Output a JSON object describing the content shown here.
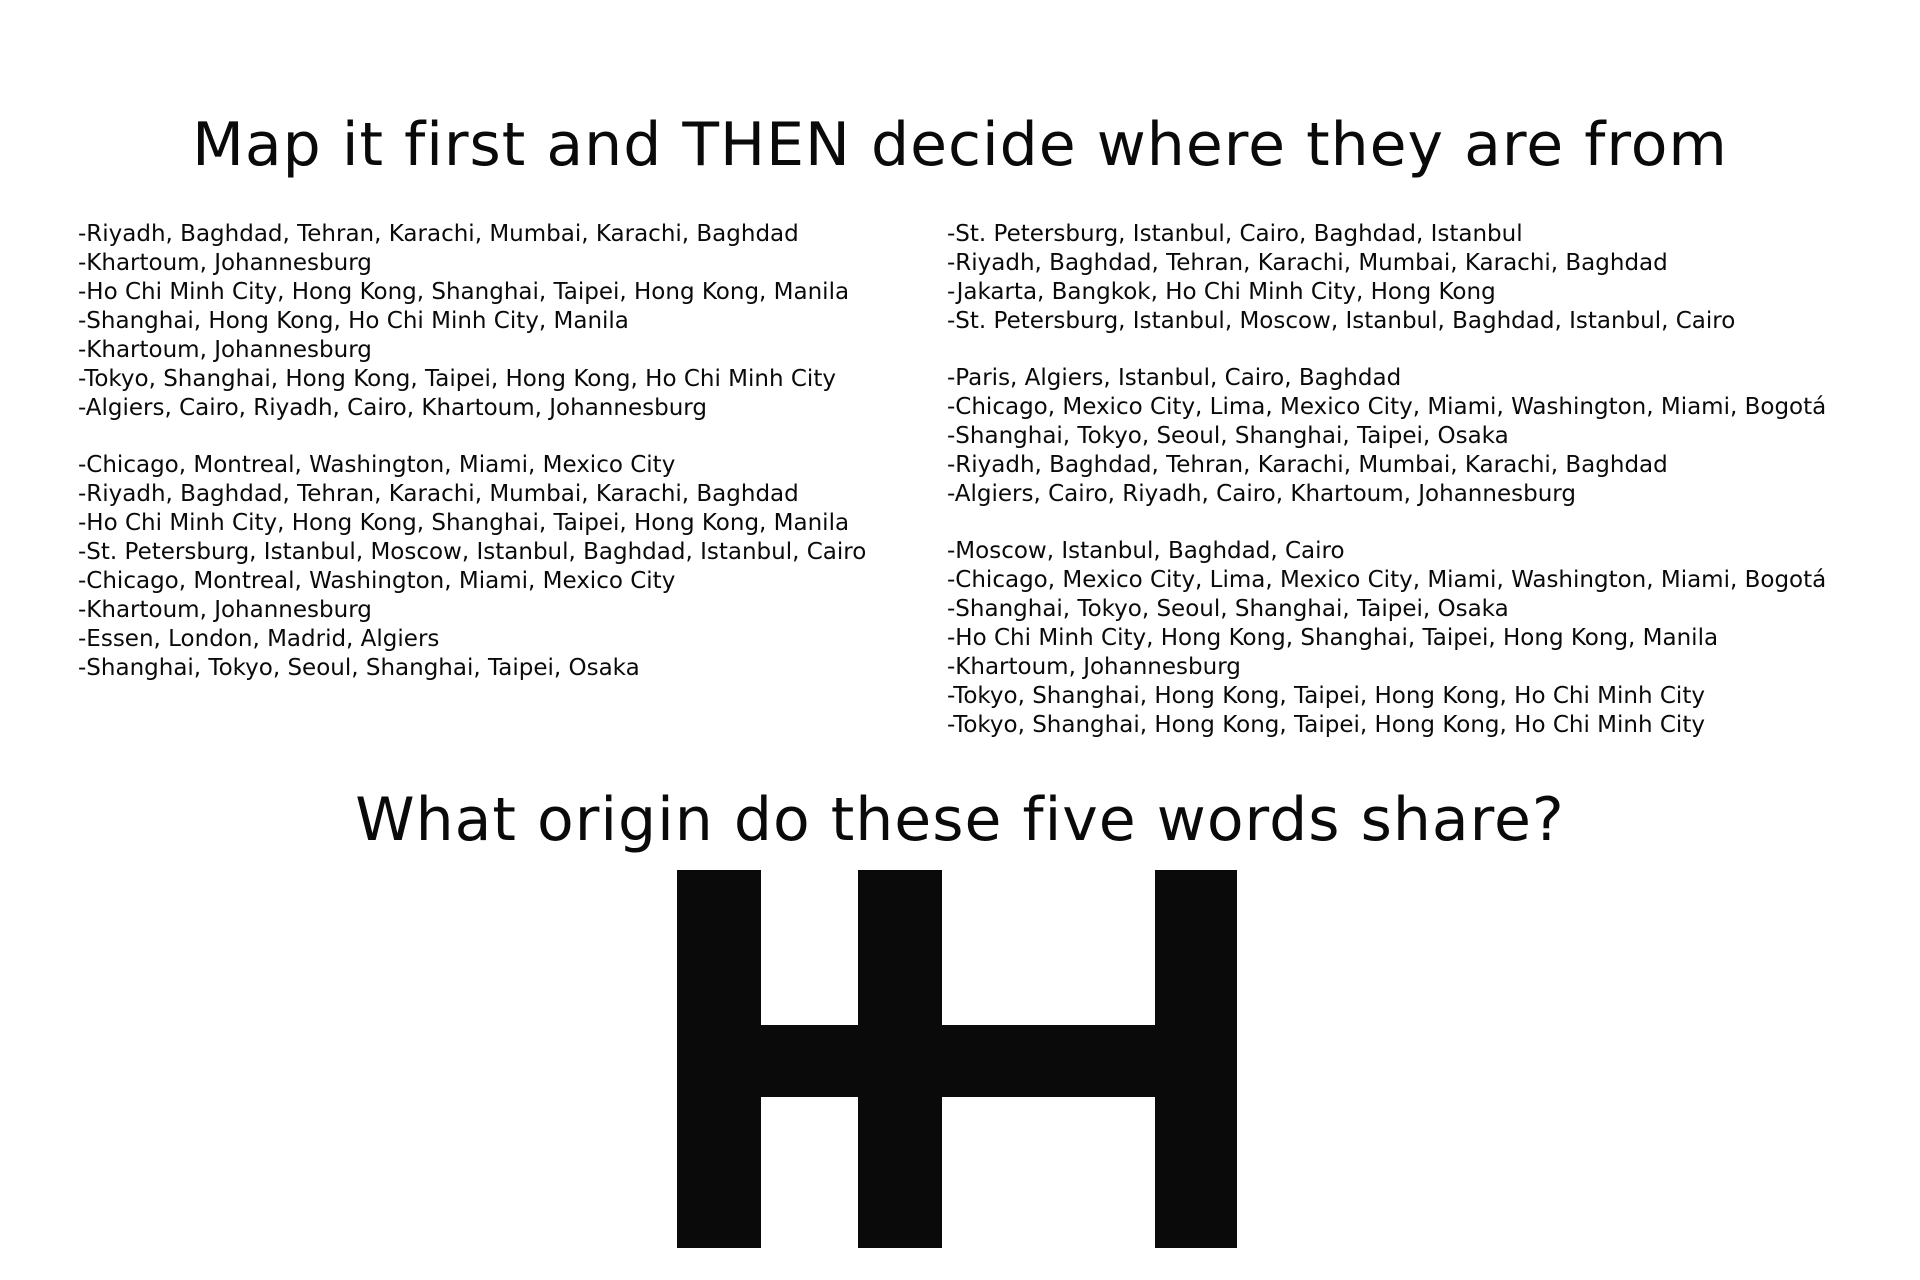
{
  "title": "Map it first and THEN decide where they are from",
  "left_column": {
    "groups": [
      [
        "-Riyadh, Baghdad, Tehran, Karachi, Mumbai, Karachi, Baghdad",
        "-Khartoum, Johannesburg",
        "-Ho Chi Minh City, Hong Kong, Shanghai, Taipei, Hong Kong, Manila",
        "-Shanghai, Hong Kong, Ho Chi Minh City, Manila",
        "-Khartoum, Johannesburg",
        "-Tokyo, Shanghai, Hong Kong, Taipei, Hong Kong, Ho Chi Minh City",
        "-Algiers, Cairo, Riyadh, Cairo, Khartoum, Johannesburg"
      ],
      [
        "-Chicago, Montreal, Washington, Miami, Mexico City",
        "-Riyadh, Baghdad, Tehran, Karachi, Mumbai, Karachi, Baghdad",
        "-Ho Chi Minh City, Hong Kong, Shanghai, Taipei, Hong Kong, Manila",
        "-St. Petersburg, Istanbul, Moscow, Istanbul, Baghdad, Istanbul, Cairo",
        "-Chicago, Montreal, Washington, Miami, Mexico City",
        "-Khartoum, Johannesburg",
        "-Essen, London, Madrid, Algiers",
        "-Shanghai, Tokyo, Seoul, Shanghai, Taipei, Osaka"
      ]
    ]
  },
  "right_column": {
    "groups": [
      [
        "-St. Petersburg, Istanbul, Cairo, Baghdad, Istanbul",
        "-Riyadh, Baghdad, Tehran, Karachi, Mumbai, Karachi, Baghdad",
        "-Jakarta, Bangkok, Ho Chi Minh City, Hong Kong",
        "-St. Petersburg, Istanbul, Moscow, Istanbul, Baghdad, Istanbul, Cairo"
      ],
      [
        "-Paris, Algiers, Istanbul, Cairo, Baghdad",
        "-Chicago, Mexico City, Lima, Mexico City, Miami, Washington, Miami, Bogotá",
        "-Shanghai, Tokyo, Seoul, Shanghai, Taipei, Osaka",
        "-Riyadh, Baghdad, Tehran, Karachi, Mumbai, Karachi, Baghdad",
        "-Algiers, Cairo, Riyadh, Cairo, Khartoum, Johannesburg"
      ],
      [
        "-Moscow, Istanbul, Baghdad, Cairo",
        "-Chicago, Mexico City, Lima, Mexico City, Miami, Washington, Miami, Bogotá",
        "-Shanghai, Tokyo, Seoul, Shanghai, Taipei, Osaka",
        "-Ho Chi Minh City, Hong Kong, Shanghai, Taipei, Hong Kong, Manila",
        "-Khartoum, Johannesburg",
        "-Tokyo, Shanghai, Hong Kong, Taipei, Hong Kong, Ho Chi Minh City",
        "-Tokyo, Shanghai, Hong Kong, Taipei, Hong Kong, Ho Chi Minh City"
      ]
    ]
  },
  "question": "What origin do these five words share?",
  "glyph": {
    "shape": "block-glyph",
    "color": "#0a0a0a"
  }
}
